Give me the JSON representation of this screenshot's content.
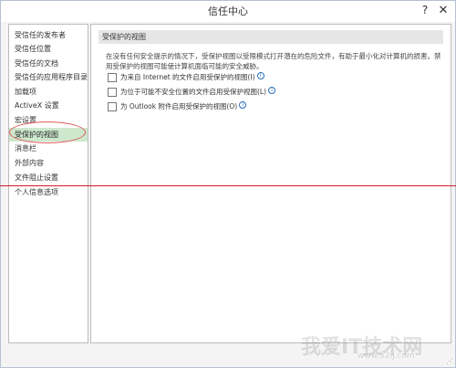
{
  "window": {
    "title": "信任中心",
    "help_label": "?",
    "close_label": "✕"
  },
  "sidebar": {
    "items": [
      {
        "label": "受信任的发布者"
      },
      {
        "label": "受信任位置"
      },
      {
        "label": "受信任的文档"
      },
      {
        "label": "受信任的应用程序目录"
      },
      {
        "label": "加载项"
      },
      {
        "label": "ActiveX 设置"
      },
      {
        "label": "宏设置"
      },
      {
        "label": "受保护的视图",
        "selected": true
      },
      {
        "label": "消息栏"
      },
      {
        "label": "外部内容"
      },
      {
        "label": "文件阻止设置"
      },
      {
        "label": "个人信息选项"
      }
    ]
  },
  "main": {
    "section_title": "受保护的视图",
    "description": "在没有任何安全提示的情况下，受保护视图以受限模式打开潜在的危险文件，有助于最小化对计算机的损害。禁用受保护的视图可能使计算机面临可能的安全威胁。",
    "options": [
      {
        "label": "为来自 Internet 的文件启用受保护的视图(I)",
        "checked": false,
        "info": true
      },
      {
        "label": "为位于可能不安全位置的文件启用受保护视图(L)",
        "checked": false,
        "info": true
      },
      {
        "label": "为 Outlook 附件启用受保护的视图(O)",
        "checked": false,
        "info": true
      }
    ]
  },
  "watermark": {
    "text": "我爱IT技术网",
    "url": "www.52ij.com"
  },
  "colors": {
    "selected_bg": "#cde8cd",
    "annotation_red": "#d21a2b"
  }
}
